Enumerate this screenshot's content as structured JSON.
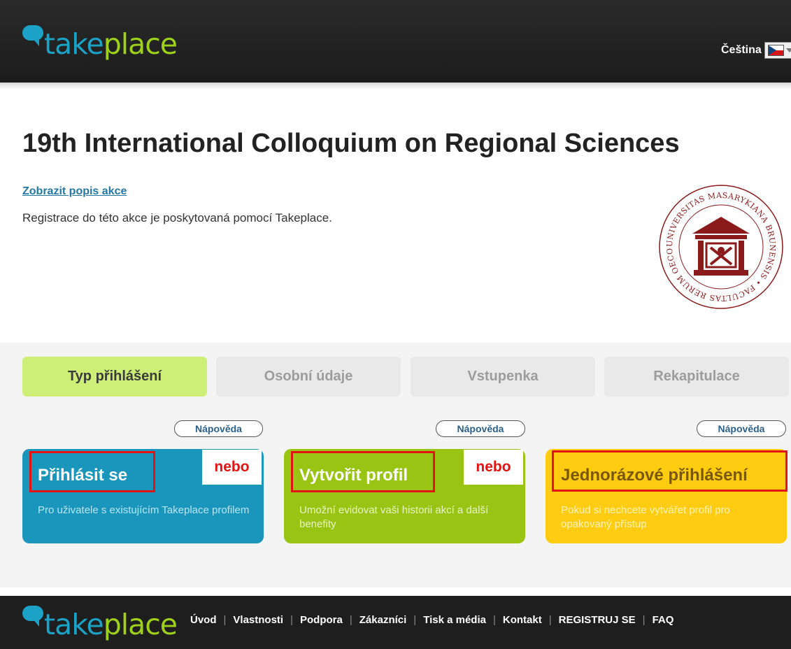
{
  "header": {
    "logo_part1": "take",
    "logo_part2": "place",
    "language_label": "Čeština",
    "language_flag": "flag-icon-cz"
  },
  "event": {
    "title": "19th International Colloquium on Regional Sciences",
    "show_description_link": "Zobrazit popis akce",
    "registration_note": "Registrace do této akce je poskytovaná pomocí Takeplace.",
    "seal_text": "UNIVERSITAS MASARYKIANA BRUNENSIS • FACULTAS RERUM OECONOMICARUM"
  },
  "steps": [
    {
      "label": "Typ přihlášení",
      "active": true
    },
    {
      "label": "Osobní údaje",
      "active": false
    },
    {
      "label": "Vstupenka",
      "active": false
    },
    {
      "label": "Rekapitulace",
      "active": false
    }
  ],
  "help_label": "Nápověda",
  "options": [
    {
      "title": "Přihlásit se",
      "description": "Pro uživatele s existujícím Takeplace profilem",
      "color": "#1a96bd"
    },
    {
      "title": "Vytvořit profil",
      "description": "Umožní evidovat vaši historii akcí a další benefity",
      "color": "#99c414"
    },
    {
      "title": "Jednorázové přihlášení",
      "description": "Pokud si nechcete vytvářet profil pro opakovaný přístup",
      "color": "#ffcc11"
    }
  ],
  "separator_label": "nebo",
  "highlight_color": "#e31313",
  "footer": {
    "logo_part1": "take",
    "logo_part2": "place",
    "nav": [
      "Úvod",
      "Vlastnosti",
      "Podpora",
      "Zákazníci",
      "Tisk a média",
      "Kontakt",
      "REGISTRUJ SE",
      "FAQ"
    ]
  }
}
